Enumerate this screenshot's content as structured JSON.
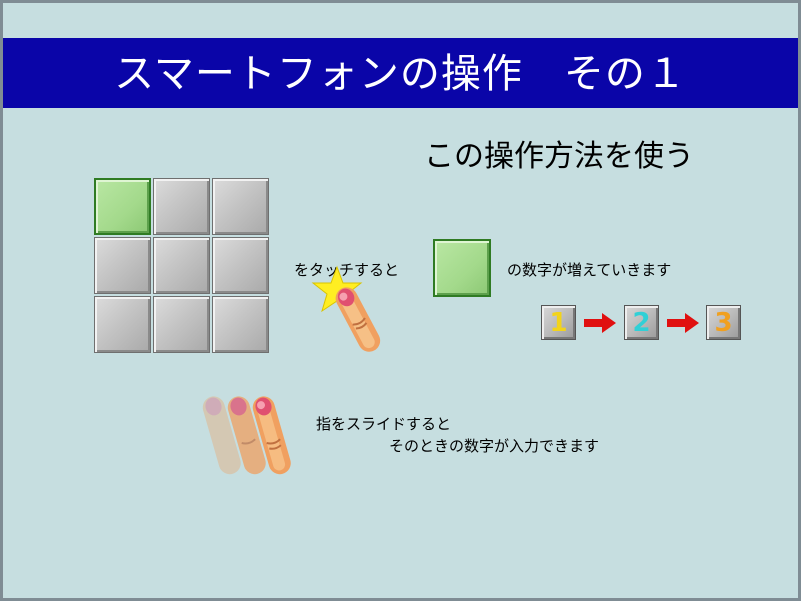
{
  "title": "スマートフォンの操作　その１",
  "subtitle": "この操作方法を使う",
  "touch": {
    "before": "をタッチすると",
    "after": "の数字が増えていきます"
  },
  "sequence": [
    {
      "label": "1",
      "color": "#f2d31b"
    },
    {
      "label": "2",
      "color": "#31d0d6"
    },
    {
      "label": "3",
      "color": "#f0a020"
    }
  ],
  "slide": {
    "line1": "指をスライドすると",
    "line2": "そのときの数字が入力できます"
  },
  "colors": {
    "title_bar": "#0a05a8",
    "background": "#c6dee0",
    "tile_green": "#a3d98b",
    "arrow_red": "#e01010",
    "star": "#ffee22"
  }
}
